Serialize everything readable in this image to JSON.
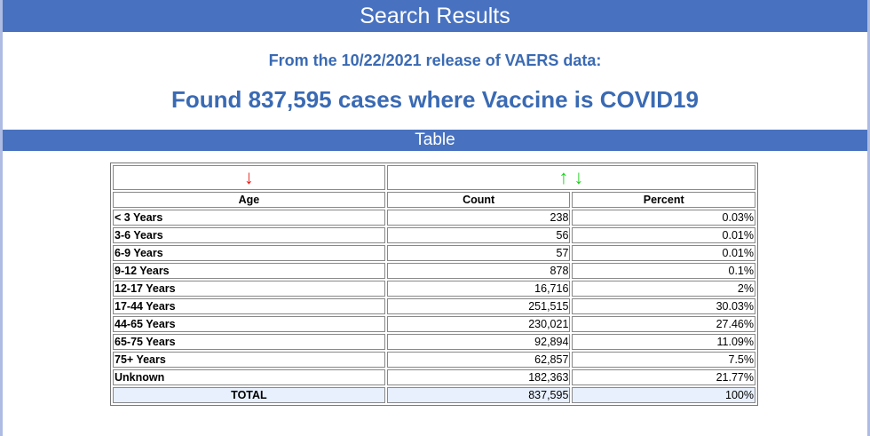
{
  "header": {
    "title": "Search Results"
  },
  "summary": {
    "release_line": "From the 10/22/2021 release of VAERS data:",
    "found_line": "Found 837,595 cases where Vaccine is COVID19"
  },
  "table_section": {
    "title": "Table"
  },
  "table": {
    "sort_arrows": {
      "age": "↓",
      "count_up": "↑",
      "count_down": "↓"
    },
    "columns": [
      "Age",
      "Count",
      "Percent"
    ],
    "rows": [
      {
        "age": "< 3 Years",
        "count": "238",
        "percent": "0.03%"
      },
      {
        "age": "3-6 Years",
        "count": "56",
        "percent": "0.01%"
      },
      {
        "age": "6-9 Years",
        "count": "57",
        "percent": "0.01%"
      },
      {
        "age": "9-12 Years",
        "count": "878",
        "percent": "0.1%"
      },
      {
        "age": "12-17 Years",
        "count": "16,716",
        "percent": "2%"
      },
      {
        "age": "17-44 Years",
        "count": "251,515",
        "percent": "30.03%"
      },
      {
        "age": "44-65 Years",
        "count": "230,021",
        "percent": "27.46%"
      },
      {
        "age": "65-75 Years",
        "count": "92,894",
        "percent": "11.09%"
      },
      {
        "age": "75+ Years",
        "count": "62,857",
        "percent": "7.5%"
      },
      {
        "age": "Unknown",
        "count": "182,363",
        "percent": "21.77%"
      }
    ],
    "total": {
      "label": "TOTAL",
      "count": "837,595",
      "percent": "100%"
    }
  },
  "colors": {
    "header_bar": "#4872c0",
    "heading_text": "#3a6ab3",
    "arrow_red": "#e8201c",
    "arrow_green": "#20d020",
    "total_row_bg": "#e8f0fe"
  }
}
